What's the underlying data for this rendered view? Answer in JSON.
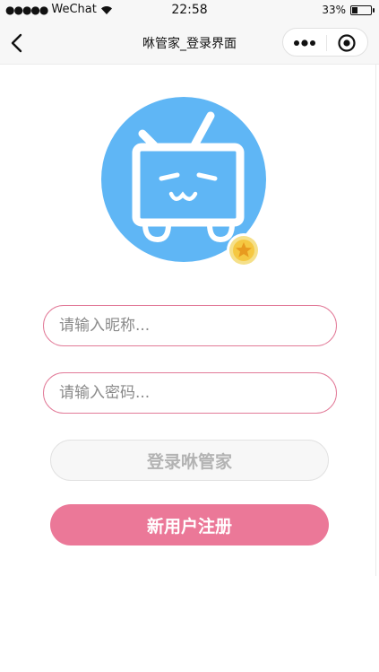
{
  "status_bar": {
    "signal_dots": "●●●●●",
    "carrier": "WeChat",
    "wifi_icon": "wifi-icon",
    "time": "22:58",
    "battery_percent": "33%",
    "battery_level": 0.33
  },
  "nav": {
    "back_icon": "chevron-left-icon",
    "title": "咻管家_登录界面",
    "more_icon": "more-dots-icon",
    "close_icon": "target-circle-icon"
  },
  "logo": {
    "icon": "tv-mascot-icon",
    "badge_icon": "star-badge-icon",
    "colors": {
      "circle": "#5fb6f5",
      "badge": "#f5c842"
    }
  },
  "form": {
    "nickname_placeholder": "请输入昵称...",
    "nickname_value": "",
    "password_placeholder": "请输入密码...",
    "password_value": ""
  },
  "buttons": {
    "login_label": "登录咻管家",
    "register_label": "新用户注册"
  },
  "colors": {
    "accent_pink": "#eb7898",
    "input_border": "#e27a98",
    "disabled_text": "#b3b3b3"
  }
}
